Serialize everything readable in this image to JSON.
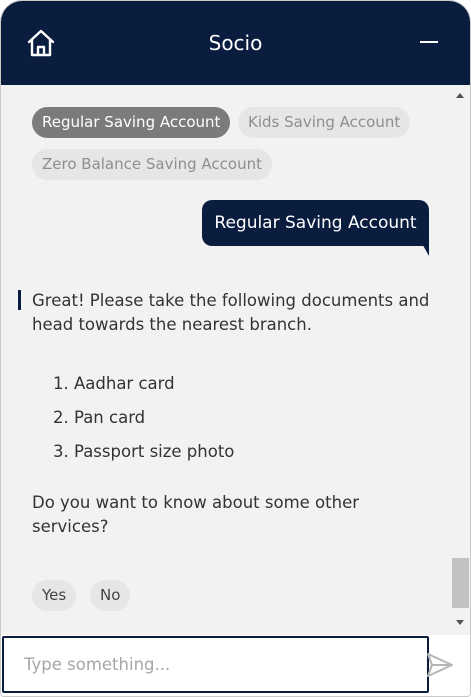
{
  "header": {
    "title": "Socio",
    "home_icon": "home-icon",
    "minimize_icon": "minimize-icon",
    "background_color": "#0b1d3f"
  },
  "quick_replies": [
    {
      "label": "Regular Saving Account",
      "selected": true
    },
    {
      "label": "Kids Saving Account",
      "selected": false
    },
    {
      "label": "Zero Balance Saving Account",
      "selected": false
    }
  ],
  "user_message": "Regular Saving Account",
  "bot_message": {
    "intro": "Great! Please take the following documents and head towards the nearest branch.",
    "documents": [
      "1. Aadhar card",
      "2. Pan card",
      "3. Passport size photo"
    ],
    "question": "Do you want to know about some other services?"
  },
  "replies": [
    "Yes",
    "No"
  ],
  "input": {
    "placeholder": "Type something...",
    "value": "",
    "send_icon": "send-icon"
  }
}
